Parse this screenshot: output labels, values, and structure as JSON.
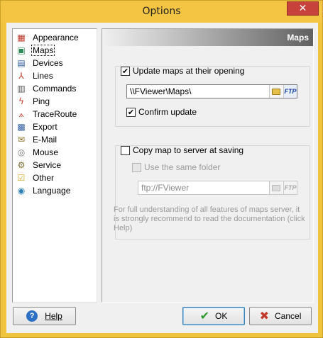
{
  "window": {
    "title": "Options",
    "close_glyph": "✕"
  },
  "nav": {
    "items": [
      {
        "label": "Appearance",
        "icon": "appearance-icon",
        "glyph": "▦",
        "color": "#c0392b"
      },
      {
        "label": "Maps",
        "icon": "maps-icon",
        "glyph": "▣",
        "color": "#2e8b57",
        "selected": true
      },
      {
        "label": "Devices",
        "icon": "devices-icon",
        "glyph": "▤",
        "color": "#2c5aa0"
      },
      {
        "label": "Lines",
        "icon": "lines-icon",
        "glyph": "⅄",
        "color": "#c0392b"
      },
      {
        "label": "Commands",
        "icon": "commands-icon",
        "glyph": "▥",
        "color": "#555555"
      },
      {
        "label": "Ping",
        "icon": "ping-icon",
        "glyph": "ϟ",
        "color": "#c0392b"
      },
      {
        "label": "TraceRoute",
        "icon": "traceroute-icon",
        "glyph": "⟑",
        "color": "#c0392b"
      },
      {
        "label": "Export",
        "icon": "export-icon",
        "glyph": "▩",
        "color": "#2c5aa0"
      },
      {
        "label": "E-Mail",
        "icon": "email-icon",
        "glyph": "✉",
        "color": "#8a6d1f"
      },
      {
        "label": "Mouse",
        "icon": "mouse-icon",
        "glyph": "◎",
        "color": "#777777"
      },
      {
        "label": "Service",
        "icon": "service-icon",
        "glyph": "⚙",
        "color": "#7a6a2a"
      },
      {
        "label": "Other",
        "icon": "other-icon",
        "glyph": "☑",
        "color": "#d4a017"
      },
      {
        "label": "Language",
        "icon": "language-icon",
        "glyph": "◉",
        "color": "#2c7fb8"
      }
    ]
  },
  "panel": {
    "header": "Maps",
    "update": {
      "label": "Update maps at their opening",
      "checked": true,
      "path": "\\\\FViewer\\Maps\\",
      "ftp_label": "FTP",
      "confirm_label": "Confirm update",
      "confirm_checked": true
    },
    "copy": {
      "label": "Copy map to server at saving",
      "checked": false,
      "same_folder_label": "Use the same folder",
      "same_folder_checked": false,
      "path": "ftp://FViewer",
      "ftp_label": "FTP",
      "note": "For full understanding of all features of maps server, it is strongly recommend to read the documentation (click Help)"
    }
  },
  "buttons": {
    "help": "Help",
    "ok": "OK",
    "cancel": "Cancel"
  },
  "colors": {
    "title_bar": "#f4c542",
    "close": "#c7423b",
    "ok_check": "#2e9a2e",
    "cancel_x": "#c0392b",
    "help_icon": "#2d6fc4"
  }
}
